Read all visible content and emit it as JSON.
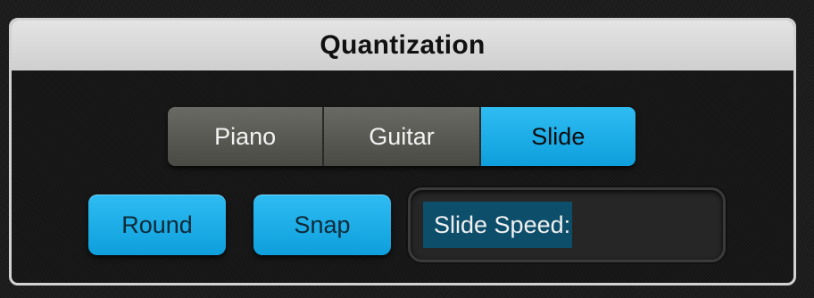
{
  "panel": {
    "title": "Quantization"
  },
  "mode_selector": {
    "options": [
      "Piano",
      "Guitar",
      "Slide"
    ],
    "selected": "Slide"
  },
  "buttons": {
    "round_label": "Round",
    "snap_label": "Snap"
  },
  "slide_speed": {
    "label": "Slide Speed:",
    "level": 0.52
  },
  "colors": {
    "accent": "#1aaee8",
    "segment_inactive": "#5a5a55",
    "header_bg": "#d8d8d8",
    "slider_fill": "#0d4e6b"
  }
}
